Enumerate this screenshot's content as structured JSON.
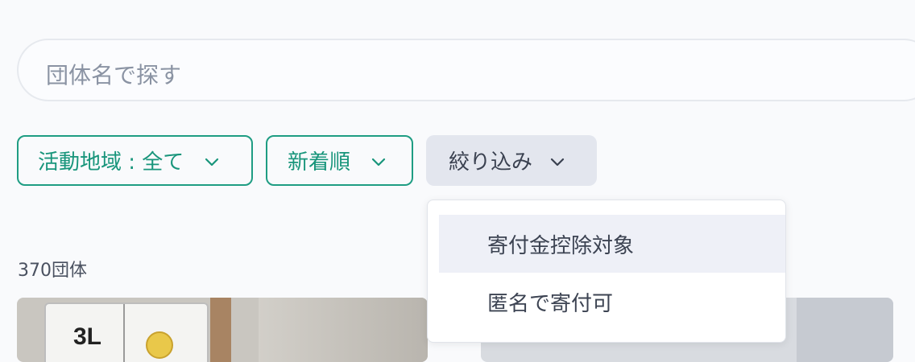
{
  "search": {
    "placeholder": "団体名で探す"
  },
  "filters": {
    "region": {
      "label": "活動地域 : 全て"
    },
    "sort": {
      "label": "新着順"
    },
    "narrow": {
      "label": "絞り込み"
    }
  },
  "results": {
    "count_text": "370団体"
  },
  "dropdown": {
    "items": [
      {
        "label": "寄付金控除対象",
        "highlighted": true
      },
      {
        "label": "匿名で寄付可",
        "highlighted": false
      }
    ]
  },
  "cards": [
    {
      "image_text": "3L"
    }
  ],
  "icons": {
    "chevron": "chevron-down-icon"
  },
  "colors": {
    "accent": "#18957b",
    "filter_active_bg": "#e3e6ee",
    "menu_highlight": "#eef0f7"
  }
}
